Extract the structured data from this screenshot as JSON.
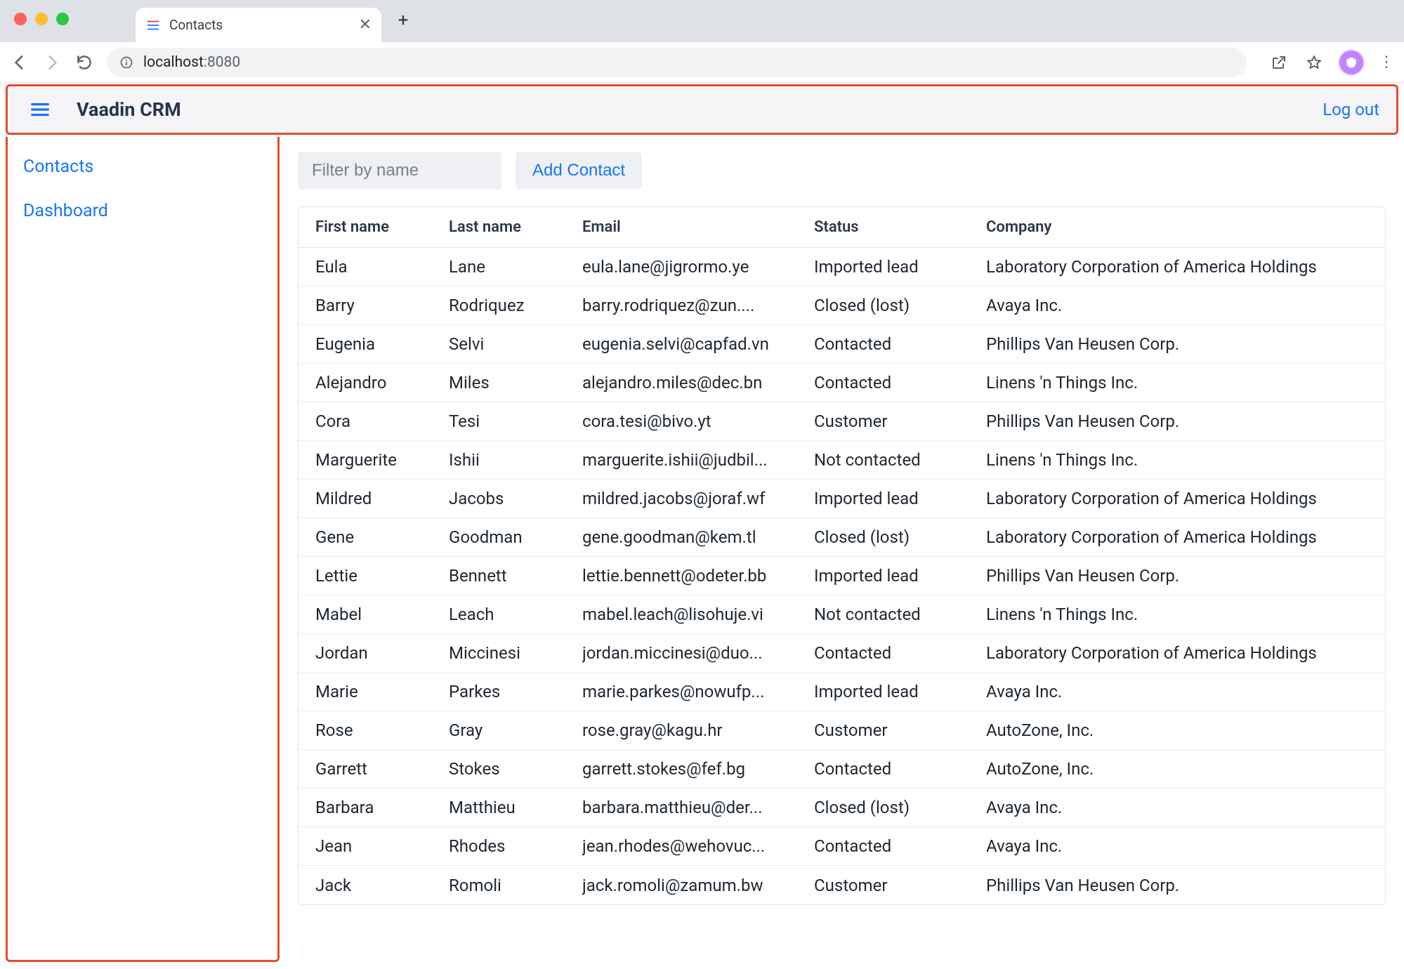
{
  "browser": {
    "tab_title": "Contacts",
    "url_prefix": "localhost",
    "url_suffix": ":8080"
  },
  "header": {
    "app_title": "Vaadin CRM",
    "logout_label": "Log out"
  },
  "sidebar": {
    "items": [
      {
        "label": "Contacts"
      },
      {
        "label": "Dashboard"
      }
    ]
  },
  "toolbar": {
    "filter_placeholder": "Filter by name",
    "add_label": "Add Contact"
  },
  "grid": {
    "columns": [
      "First name",
      "Last name",
      "Email",
      "Status",
      "Company"
    ],
    "rows": [
      {
        "first": "Eula",
        "last": "Lane",
        "email": "eula.lane@jigrormo.ye",
        "status": "Imported lead",
        "company": "Laboratory Corporation of America Holdings"
      },
      {
        "first": "Barry",
        "last": "Rodriquez",
        "email": "barry.rodriquez@zun....",
        "status": "Closed (lost)",
        "company": "Avaya Inc."
      },
      {
        "first": "Eugenia",
        "last": "Selvi",
        "email": "eugenia.selvi@capfad.vn",
        "status": "Contacted",
        "company": "Phillips Van Heusen Corp."
      },
      {
        "first": "Alejandro",
        "last": "Miles",
        "email": "alejandro.miles@dec.bn",
        "status": "Contacted",
        "company": "Linens 'n Things Inc."
      },
      {
        "first": "Cora",
        "last": "Tesi",
        "email": "cora.tesi@bivo.yt",
        "status": "Customer",
        "company": "Phillips Van Heusen Corp."
      },
      {
        "first": "Marguerite",
        "last": "Ishii",
        "email": "marguerite.ishii@judbil...",
        "status": "Not contacted",
        "company": "Linens 'n Things Inc."
      },
      {
        "first": "Mildred",
        "last": "Jacobs",
        "email": "mildred.jacobs@joraf.wf",
        "status": "Imported lead",
        "company": "Laboratory Corporation of America Holdings"
      },
      {
        "first": "Gene",
        "last": "Goodman",
        "email": "gene.goodman@kem.tl",
        "status": "Closed (lost)",
        "company": "Laboratory Corporation of America Holdings"
      },
      {
        "first": "Lettie",
        "last": "Bennett",
        "email": "lettie.bennett@odeter.bb",
        "status": "Imported lead",
        "company": "Phillips Van Heusen Corp."
      },
      {
        "first": "Mabel",
        "last": "Leach",
        "email": "mabel.leach@lisohuje.vi",
        "status": "Not contacted",
        "company": "Linens 'n Things Inc."
      },
      {
        "first": "Jordan",
        "last": "Miccinesi",
        "email": "jordan.miccinesi@duo...",
        "status": "Contacted",
        "company": "Laboratory Corporation of America Holdings"
      },
      {
        "first": "Marie",
        "last": "Parkes",
        "email": "marie.parkes@nowufp...",
        "status": "Imported lead",
        "company": "Avaya Inc."
      },
      {
        "first": "Rose",
        "last": "Gray",
        "email": "rose.gray@kagu.hr",
        "status": "Customer",
        "company": "AutoZone, Inc."
      },
      {
        "first": "Garrett",
        "last": "Stokes",
        "email": "garrett.stokes@fef.bg",
        "status": "Contacted",
        "company": "AutoZone, Inc."
      },
      {
        "first": "Barbara",
        "last": "Matthieu",
        "email": "barbara.matthieu@der...",
        "status": "Closed (lost)",
        "company": "Avaya Inc."
      },
      {
        "first": "Jean",
        "last": "Rhodes",
        "email": "jean.rhodes@wehovuc...",
        "status": "Contacted",
        "company": "Avaya Inc."
      },
      {
        "first": "Jack",
        "last": "Romoli",
        "email": "jack.romoli@zamum.bw",
        "status": "Customer",
        "company": "Phillips Van Heusen Corp."
      }
    ]
  }
}
